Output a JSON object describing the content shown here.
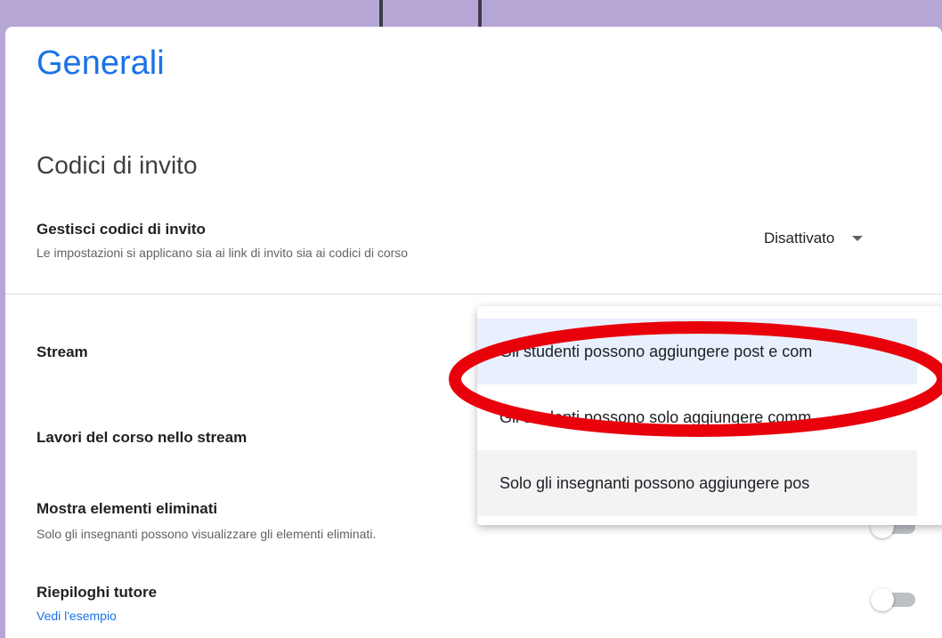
{
  "page": {
    "title": "Generali"
  },
  "invite_codes": {
    "section_title": "Codici di invito",
    "manage_label": "Gestisci codici di invito",
    "manage_desc": "Le impostazioni si applicano sia ai link di invito sia ai codici di corso",
    "selected_value": "Disattivato"
  },
  "settings": {
    "stream_label": "Stream",
    "coursework_label": "Lavori del corso nello stream",
    "show_deleted_label": "Mostra elementi eliminati",
    "show_deleted_desc": "Solo gli insegnanti possono visualizzare gli elementi eliminati.",
    "guardian_label": "Riepiloghi tutore",
    "guardian_link": "Vedi l'esempio"
  },
  "stream_menu": {
    "options": [
      "Gli studenti possono aggiungere post e com",
      "Gli studenti possono solo aggiungere comm",
      "Solo gli insegnanti possono aggiungere pos"
    ],
    "selected_index": 0
  },
  "colors": {
    "accent": "#1a73e8",
    "background": "#b6a6d6",
    "annotation": "#e8000b",
    "selected_option": "#e8f0fe"
  }
}
